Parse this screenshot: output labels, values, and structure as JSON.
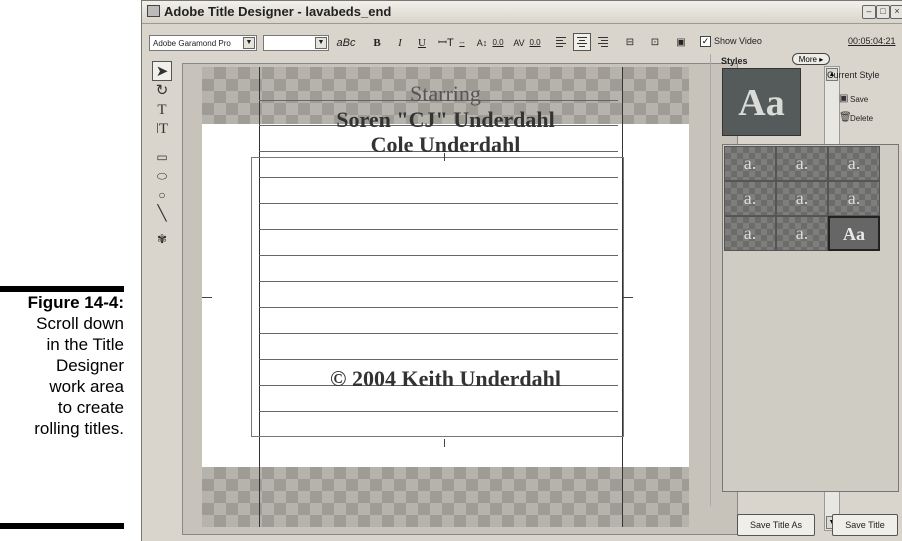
{
  "caption": {
    "label": "Figure 14-4:",
    "lines": [
      "Scroll down",
      "in the Title",
      "Designer",
      "work area",
      "to create",
      "rolling titles."
    ]
  },
  "window": {
    "title": "Adobe Title Designer - lavabeds_end"
  },
  "toolbar": {
    "font": "Adobe Garamond Pro",
    "style": "",
    "small_caps": "aBc",
    "bold": "B",
    "italic": "I",
    "underline": "U",
    "leading_value": "0.0",
    "kerning_value": "0.0",
    "tracking_value": "0.0",
    "show_video_label": "Show Video",
    "show_video_checked": true,
    "timecode": "00:05:04:21",
    "more_label": "More ▸"
  },
  "tools": [
    "selection-tool",
    "rotation-tool",
    "type-tool",
    "vertical-type-tool",
    "rectangle-tool",
    "rounded-rectangle-tool",
    "ellipse-tool",
    "line-tool",
    "logo-tool"
  ],
  "canvas": {
    "lines": [
      {
        "text": "Starring",
        "style": "light"
      },
      {
        "text": "Soren \"CJ\" Underdahl",
        "style": "bold"
      },
      {
        "text": "Cole Underdahl",
        "style": "bold"
      },
      {
        "text": "© 2004 Keith Underdahl",
        "style": "bold"
      }
    ]
  },
  "styles": {
    "heading": "Styles",
    "current_style_label": "Current Style",
    "preview_text": "Aa",
    "save_label": "Save",
    "delete_label": "Delete",
    "swatches": [
      "a.",
      "a.",
      "a.",
      "a.",
      "a.",
      "a.",
      "a.",
      "a.",
      "Aa"
    ]
  },
  "buttons": {
    "save_title_as": "Save Title As",
    "save_title": "Save Title"
  }
}
